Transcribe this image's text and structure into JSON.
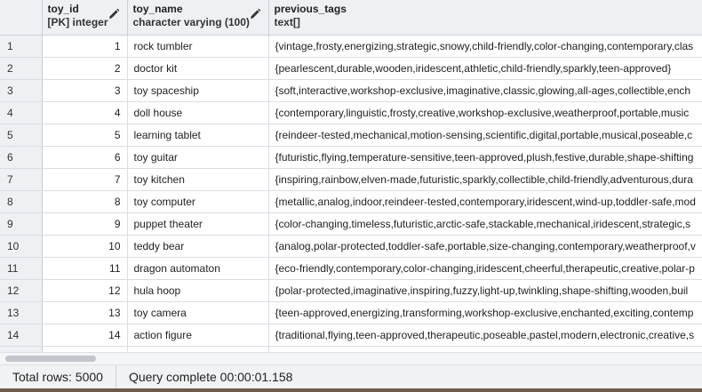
{
  "columns": [
    {
      "name": "toy_id",
      "type": "[PK] integer"
    },
    {
      "name": "toy_name",
      "type": "character varying (100)"
    },
    {
      "name": "previous_tags",
      "type": "text[]"
    }
  ],
  "rows": [
    {
      "n": "1",
      "id": "1",
      "name": "rock tumbler",
      "tags": "{vintage,frosty,energizing,strategic,snowy,child-friendly,color-changing,contemporary,clas"
    },
    {
      "n": "2",
      "id": "2",
      "name": "doctor kit",
      "tags": "{pearlescent,durable,wooden,iridescent,athletic,child-friendly,sparkly,teen-approved}"
    },
    {
      "n": "3",
      "id": "3",
      "name": "toy spaceship",
      "tags": "{soft,interactive,workshop-exclusive,imaginative,classic,glowing,all-ages,collectible,ench"
    },
    {
      "n": "4",
      "id": "4",
      "name": "doll house",
      "tags": "{contemporary,linguistic,frosty,creative,workshop-exclusive,weatherproof,portable,music"
    },
    {
      "n": "5",
      "id": "5",
      "name": "learning tablet",
      "tags": "{reindeer-tested,mechanical,motion-sensing,scientific,digital,portable,musical,poseable,c"
    },
    {
      "n": "6",
      "id": "6",
      "name": "toy guitar",
      "tags": "{futuristic,flying,temperature-sensitive,teen-approved,plush,festive,durable,shape-shifting"
    },
    {
      "n": "7",
      "id": "7",
      "name": "toy kitchen",
      "tags": "{inspiring,rainbow,elven-made,futuristic,sparkly,collectible,child-friendly,adventurous,dura"
    },
    {
      "n": "8",
      "id": "8",
      "name": "toy computer",
      "tags": "{metallic,analog,indoor,reindeer-tested,contemporary,iridescent,wind-up,toddler-safe,mod"
    },
    {
      "n": "9",
      "id": "9",
      "name": "puppet theater",
      "tags": "{color-changing,timeless,futuristic,arctic-safe,stackable,mechanical,iridescent,strategic,s"
    },
    {
      "n": "10",
      "id": "10",
      "name": "teddy bear",
      "tags": "{analog,polar-protected,toddler-safe,portable,size-changing,contemporary,weatherproof,v"
    },
    {
      "n": "11",
      "id": "11",
      "name": "dragon automaton",
      "tags": "{eco-friendly,contemporary,color-changing,iridescent,cheerful,therapeutic,creative,polar-p"
    },
    {
      "n": "12",
      "id": "12",
      "name": "hula hoop",
      "tags": "{polar-protected,imaginative,inspiring,fuzzy,light-up,twinkling,shape-shifting,wooden,buil"
    },
    {
      "n": "13",
      "id": "13",
      "name": "toy camera",
      "tags": "{teen-approved,energizing,transforming,workshop-exclusive,enchanted,exciting,contemp"
    },
    {
      "n": "14",
      "id": "14",
      "name": "action figure",
      "tags": "{traditional,flying,teen-approved,therapeutic,poseable,pastel,modern,electronic,creative,s"
    }
  ],
  "status": {
    "total_rows": "Total rows: 5000",
    "query": "Query complete 00:00:01.158"
  },
  "icons": {
    "edit_column": "pencil-icon"
  },
  "colors": {
    "header_bg": "#eef0f3",
    "grid_line": "#d9dde3",
    "status_bg": "#f1f2f4"
  }
}
